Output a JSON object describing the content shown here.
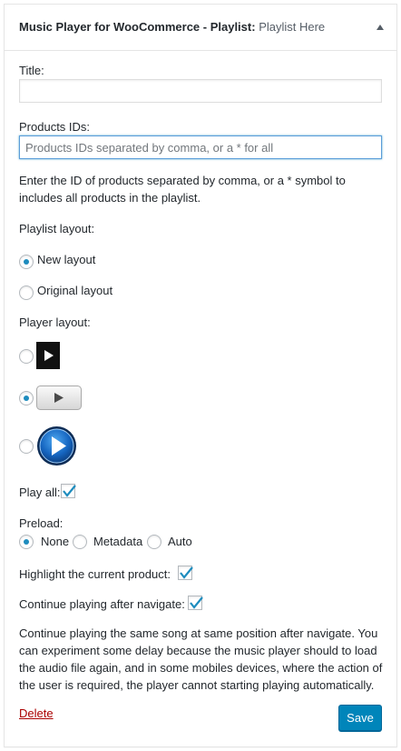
{
  "widget": {
    "title": "Music Player for WooCommerce - Playlist:",
    "title_sub": "Playlist Here"
  },
  "form": {
    "title_label": "Title:",
    "title_value": "",
    "products_label": "Products IDs:",
    "products_placeholder": "Products IDs separated by comma, or a * for all",
    "products_value": "",
    "products_help_line1": "Enter the ID of products separated by comma, or a * symbol to",
    "products_help_line2": "includes all products in the playlist.",
    "playlist_layout_label": "Playlist layout:",
    "playlist_layouts": [
      {
        "label": "New layout",
        "checked": true
      },
      {
        "label": "Original layout",
        "checked": false
      }
    ],
    "player_layout_label": "Player layout:",
    "player_layouts": [
      {
        "skin": "dark-square-play",
        "checked": false
      },
      {
        "skin": "gray-rounded-play",
        "checked": true
      },
      {
        "skin": "blue-circle-play",
        "checked": false
      }
    ],
    "play_all_label": "Play all:",
    "play_all_checked": true,
    "preload_label": "Preload:",
    "preload_options": [
      {
        "label": "None",
        "checked": true
      },
      {
        "label": "Metadata",
        "checked": false
      },
      {
        "label": "Auto",
        "checked": false
      }
    ],
    "highlight_label": "Highlight the current product:",
    "highlight_checked": true,
    "continue_label": "Continue playing after navigate:",
    "continue_checked": true,
    "continue_help_lines": [
      "Continue playing the same song at same position after navigate. You",
      "can experiment some delay because the music player should to load",
      "the audio file again, and in some mobiles devices, where the action of",
      "the user is required, the player cannot starting playing automatically."
    ]
  },
  "actions": {
    "delete_label": "Delete",
    "save_label": "Save"
  },
  "colors": {
    "accent": "#0085ba",
    "radio_dot": "#1e8cbe",
    "delete": "#aa0000"
  }
}
